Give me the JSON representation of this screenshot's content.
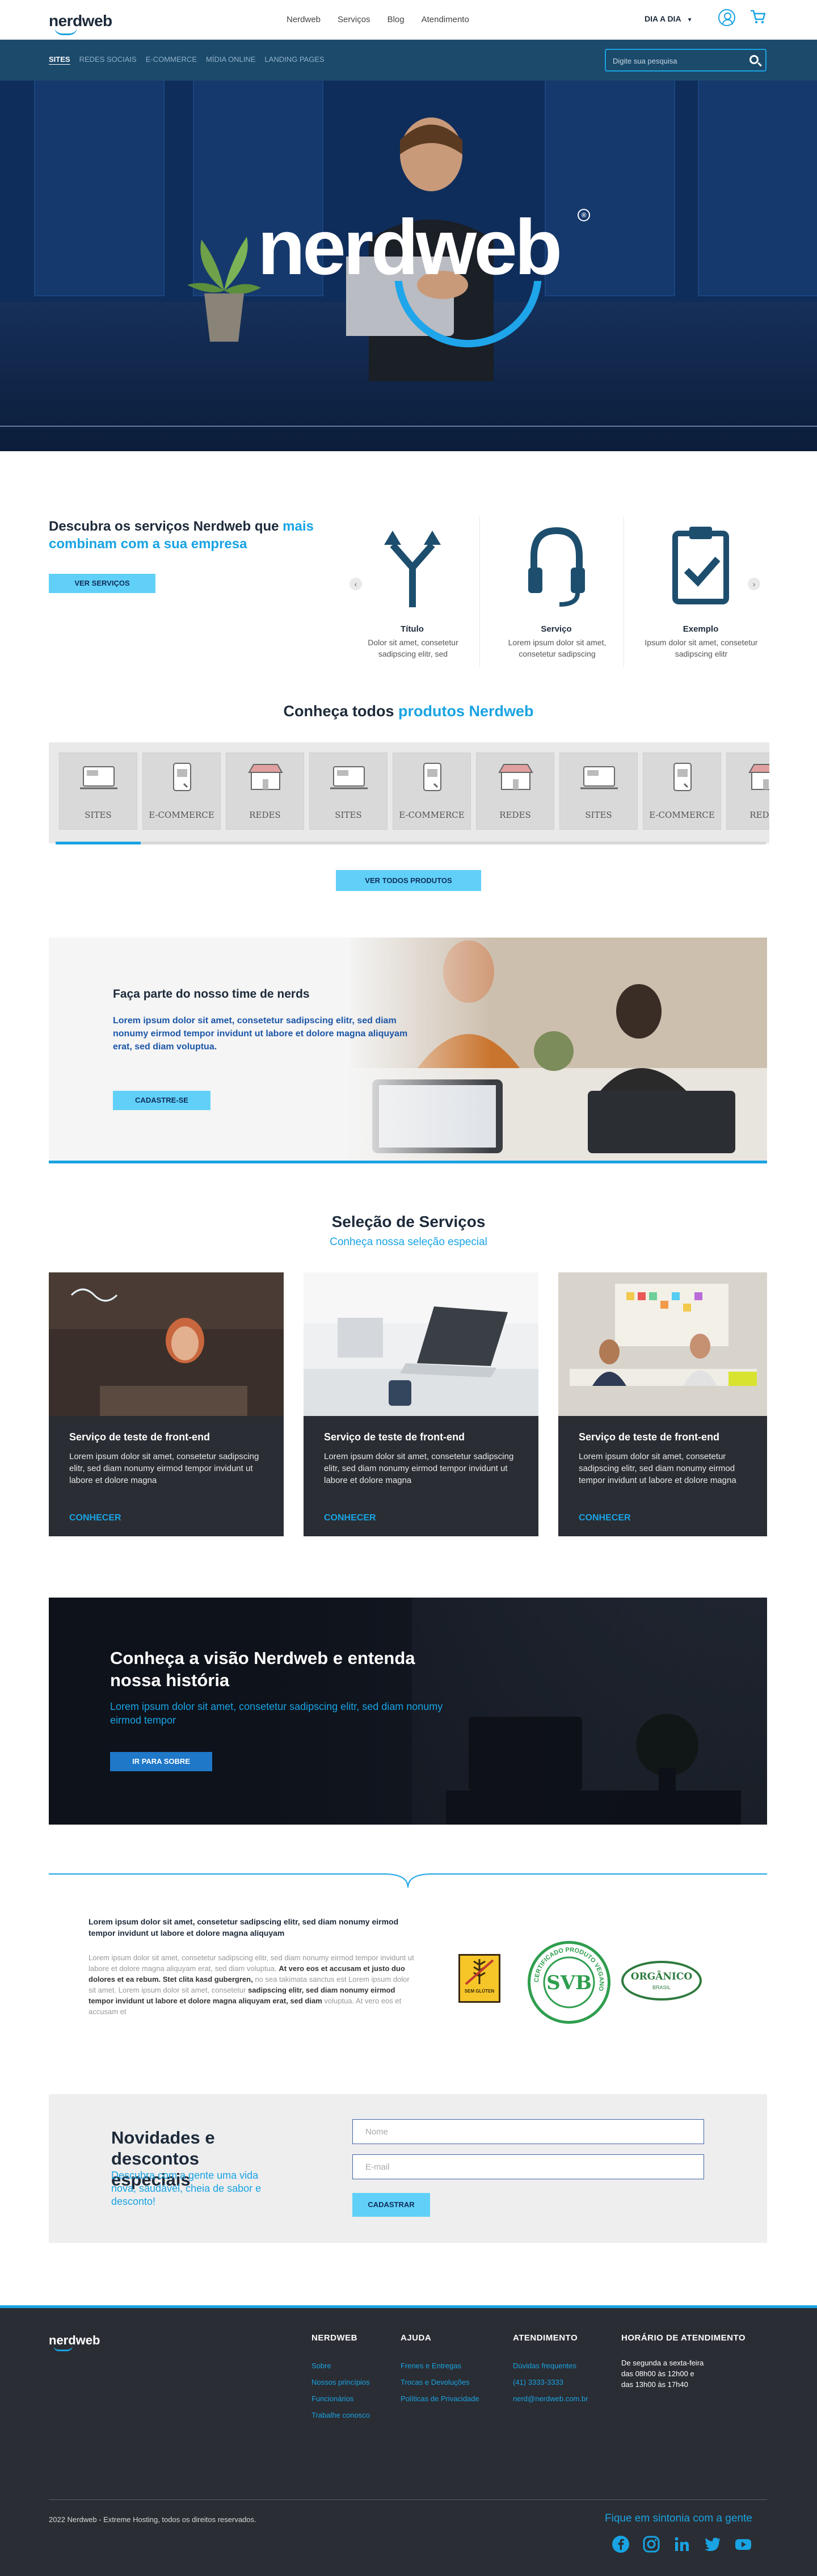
{
  "header": {
    "logo": "nerdweb",
    "menu": [
      "Nerdweb",
      "Serviços",
      "Blog",
      "Atendimento"
    ],
    "day_selector": "DIA A DIA",
    "icons": [
      "user-icon",
      "cart-icon"
    ]
  },
  "subnav": {
    "categories": [
      "SITES",
      "REDES SOCIAIS",
      "E-COMMERCE",
      "MÍDIA ONLINE",
      "LANDING PAGES"
    ],
    "search_placeholder": "Digite sua pesquisa"
  },
  "hero": {
    "wordmark": "nerdweb",
    "registered": "®"
  },
  "services": {
    "title_main": "Descubra os serviços Nerdweb que ",
    "title_highlight": "mais combinam com a sua empresa",
    "button": "VER SERVIÇOS",
    "cards": [
      {
        "title": "Título",
        "text": "Dolor sit amet, consetetur sadipscing elitr, sed",
        "icon": "fork-arrows-icon"
      },
      {
        "title": "Serviço",
        "text": "Lorem ipsum dolor sit amet, consetetur sadipscing",
        "icon": "headset-icon"
      },
      {
        "title": "Exemplo",
        "text": "Ipsum dolor sit amet, consetetur sadipscing elitr",
        "icon": "clipboard-check-icon"
      }
    ]
  },
  "products": {
    "title_main": "Conheça todos ",
    "title_highlight": "produtos Nerdweb",
    "items": [
      "SITES",
      "E-COMMERCE",
      "REDES",
      "SITES",
      "E-COMMERCE",
      "REDES",
      "SITES",
      "E-COMMERCE",
      "REDES"
    ],
    "progress": 0.12,
    "button": "VER TODOS PRODUTOS"
  },
  "team": {
    "title": "Faça parte do nosso time de nerds",
    "text": "Lorem ipsum dolor sit amet, consetetur sadipscing elitr, sed diam nonumy eirmod tempor invidunt ut labore et dolore magna aliquyam erat, sed diam voluptua.",
    "button": "CADASTRE-SE"
  },
  "selection": {
    "title": "Seleção de Serviços",
    "subtitle": "Conheça nossa seleção especial",
    "cards": [
      {
        "title": "Serviço de teste de front-end",
        "text": "Lorem ipsum dolor sit amet, consetetur sadipscing elitr, sed diam nonumy eirmod tempor invidunt ut labore et dolore magna",
        "cta": "CONHECER"
      },
      {
        "title": "Serviço de teste de front-end",
        "text": "Lorem ipsum dolor sit amet, consetetur sadipscing elitr, sed diam nonumy eirmod tempor invidunt ut labore et dolore magna",
        "cta": "CONHECER"
      },
      {
        "title": "Serviço de teste de front-end",
        "text": "Lorem ipsum dolor sit amet, consetetur sadipscing elitr, sed diam nonumy eirmod tempor invidunt ut labore et dolore magna",
        "cta": "CONHECER"
      }
    ]
  },
  "vision": {
    "title": "Conheça a visão Nerdweb e entenda nossa história",
    "text": "Lorem ipsum dolor sit amet, consetetur sadipscing elitr, sed diam nonumy eirmod tempor",
    "button": "IR PARA SOBRE"
  },
  "certificates": {
    "title": "Lorem ipsum dolor sit amet, consetetur sadipscing elitr, sed diam nonumy eirmod tempor invidunt ut labore et dolore magna aliquyam",
    "body_1": "Lorem ipsum dolor sit amet, consetetur sadipscing elitr, sed diam nonumy eirmod tempor invidunt ut labore et dolore magna aliquyam erat, sed diam voluptua. ",
    "body_2": "At vero eos et accusam et justo duo dolores et ea rebum. Stet clita kasd gubergren,",
    "body_3": " no sea takimata sanctus est Lorem ipsum dolor sit amet. Lorem ipsum dolor sit amet, consetetur ",
    "body_4": "sadipscing elitr, sed diam nonumy eirmod tempor invidunt ut labore et dolore magna aliquyam erat, sed diam",
    "body_5": " voluptua. At vero eos et accusam et",
    "seals": {
      "seal_1": "SEM GLÚTEN",
      "seal_2_arc": "CERTIFICADO PRODUTO VEGANO",
      "seal_2_center": "SVB",
      "seal_3": "ORGÂNICO",
      "seal_3_country": "BRASIL"
    }
  },
  "newsletter": {
    "title": "Novidades e descontos especiais",
    "text": "Descubra com a gente uma vida nova, saudável, cheia de sabor e desconto!",
    "name_placeholder": "Nome",
    "email_placeholder": "E-mail",
    "button": "CADASTRAR"
  },
  "footer": {
    "logo": "nerdweb",
    "columns": [
      {
        "title": "NERDWEB",
        "links": [
          "Sobre",
          "Nossos princípios",
          "Funcionários",
          "Trabalhe conosco"
        ]
      },
      {
        "title": "AJUDA",
        "links": [
          "Frenes e Entregas",
          "Trocas e Devoluções",
          "Políticas de Privacidade"
        ]
      },
      {
        "title": "ATENDIMENTO",
        "links": [
          "Dúvidas frequentes",
          "(41) 3333-3333",
          "nerd@nerdweb.com.br"
        ]
      }
    ],
    "hours_title": "HORÁRIO DE ATENDIMENTO",
    "hours_lines": [
      "De segunda a sexta-feira",
      "das 08h00 às 12h00 e",
      "das 13h00 às 17h40"
    ],
    "copyright": "2022 Nerdweb - Extreme Hosting, todos os direitos reservados.",
    "tagline": "Fique em sintonia com a gente",
    "social": [
      "facebook-icon",
      "instagram-icon",
      "linkedin-icon",
      "twitter-icon",
      "youtube-icon"
    ]
  },
  "colors": {
    "accent": "#19a3e3",
    "button": "#61d0f8",
    "dark": "#2a2d33",
    "navy": "#1c4a6b"
  }
}
